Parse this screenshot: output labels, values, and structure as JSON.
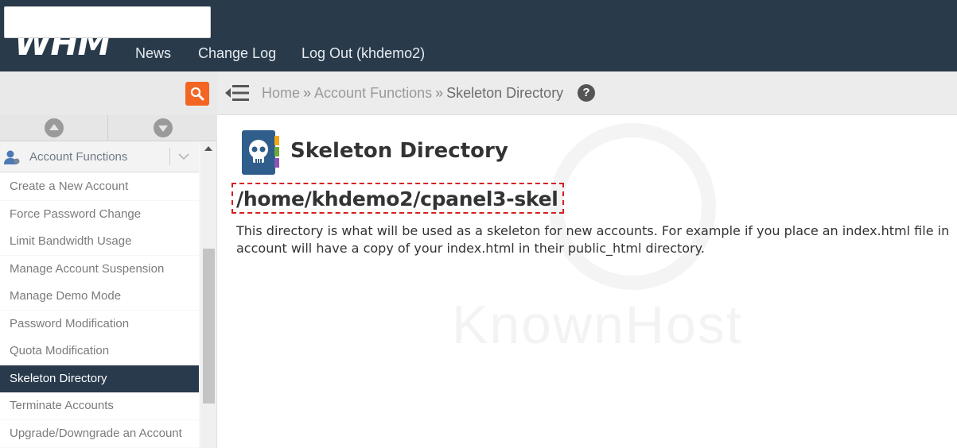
{
  "header": {
    "logo": "WHM",
    "nav": [
      "News",
      "Change Log",
      "Log Out (khdemo2)"
    ]
  },
  "search": {
    "value": "",
    "placeholder": ""
  },
  "breadcrumb": {
    "items": [
      "Home",
      "Account Functions",
      "Skeleton Directory"
    ],
    "separator": "»"
  },
  "sidebar": {
    "category": "Account Functions",
    "items": [
      "Create a New Account",
      "Force Password Change",
      "Limit Bandwidth Usage",
      "Manage Account Suspension",
      "Manage Demo Mode",
      "Password Modification",
      "Quota Modification",
      "Skeleton Directory",
      "Terminate Accounts",
      "Upgrade/Downgrade an Account"
    ],
    "active_index": 7
  },
  "main": {
    "title": "Skeleton Directory",
    "directory": "/home/khdemo2/cpanel3-skel",
    "description_line1": "This directory is what will be used as a skeleton for new accounts. For example if you place an index.html file in",
    "description_line2": "account will have a copy of your index.html in their public_html directory.",
    "watermark": "KnownHost"
  },
  "colors": {
    "topbar": "#293a4a",
    "search_button": "#f26522",
    "active_item": "#283a4c",
    "highlight_border": "#d42020"
  },
  "icons": {
    "search": "search-icon",
    "menu": "hamburger-icon",
    "help": "help-icon",
    "page": "skull-book-icon"
  }
}
